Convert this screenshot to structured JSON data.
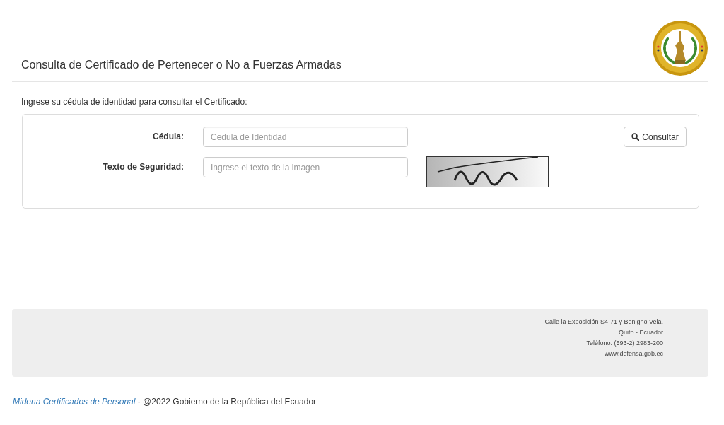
{
  "header": {
    "title": "Consulta de Certificado de Pertenecer o No a Fuerzas Armadas"
  },
  "intro": "Ingrese su cédula de identidad para consultar el Certificado:",
  "form": {
    "fields": [
      {
        "kind": "text",
        "label": "Cédula:",
        "placeholder": "Cedula de Identidad"
      },
      {
        "kind": "captcha",
        "label": "Texto de Seguridad:",
        "placeholder": "Ingrese el texto de la imagen"
      }
    ],
    "button": "Consultar"
  },
  "contact": [
    "Calle la Exposición S4-71 y Benigno Vela.",
    "Quito - Ecuador",
    "Teléfono: (593-2) 2983-200",
    "www.defensa.gob.ec"
  ],
  "footer": {
    "link": "Midena Certificados de Personal",
    "text": "- @2022 Gobierno de la República del Ecuador"
  }
}
